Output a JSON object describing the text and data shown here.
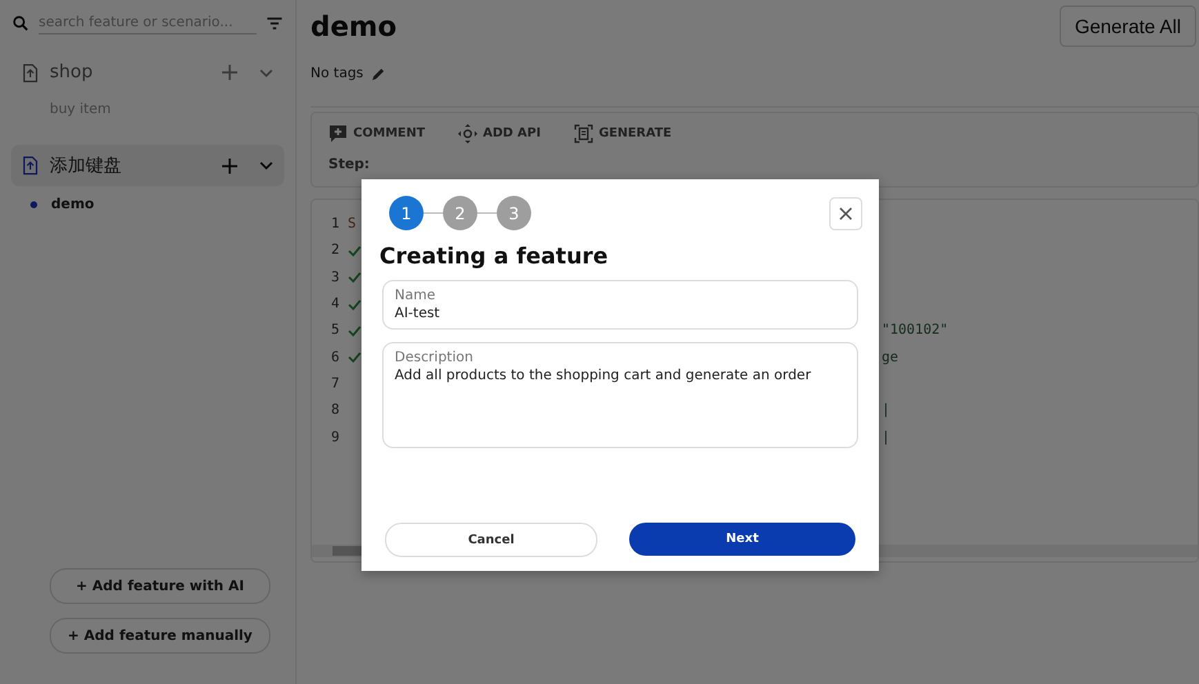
{
  "sidebar": {
    "search": {
      "placeholder": "search feature or scenario..."
    },
    "groups": [
      {
        "name": "shop",
        "selected": false,
        "children": [
          {
            "name": "buy item",
            "selected": false
          }
        ]
      },
      {
        "name": "添加键盘",
        "selected": true,
        "children": [
          {
            "name": "demo",
            "selected": true
          }
        ]
      }
    ],
    "buttons": [
      "+ Add feature with AI",
      "+ Add feature manually"
    ]
  },
  "main": {
    "title": "demo",
    "generate_all": "Generate All",
    "tags": "No tags",
    "toolbar": [
      {
        "label": "COMMENT",
        "kind": "comment"
      },
      {
        "label": "ADD API",
        "kind": "api"
      },
      {
        "label": "GENERATE",
        "kind": "generate"
      }
    ],
    "step_label": "Step:",
    "editor": {
      "lines": [
        {
          "number": "1",
          "passed": false,
          "text": "S"
        },
        {
          "number": "2",
          "passed": true
        },
        {
          "number": "3",
          "passed": true
        },
        {
          "number": "4",
          "passed": true
        },
        {
          "number": "5",
          "passed": true,
          "right": "\"100102\""
        },
        {
          "number": "6",
          "passed": true,
          "right": "ge"
        },
        {
          "number": "7",
          "passed": false
        },
        {
          "number": "8",
          "passed": false,
          "right": "|"
        },
        {
          "number": "9",
          "passed": false,
          "right": "|"
        }
      ]
    }
  },
  "dialog": {
    "steps": [
      {
        "label": "1",
        "selected": true
      },
      {
        "label": "2",
        "selected": false
      },
      {
        "label": "3",
        "selected": false
      }
    ],
    "title": "Creating a feature",
    "fields": [
      {
        "label": "Name",
        "value": "AI-test",
        "kind": "input"
      },
      {
        "label": "Description",
        "value": "Add all products to the shopping cart and generate an order",
        "kind": "textarea"
      }
    ],
    "cancel": "Cancel",
    "next": "Next"
  }
}
